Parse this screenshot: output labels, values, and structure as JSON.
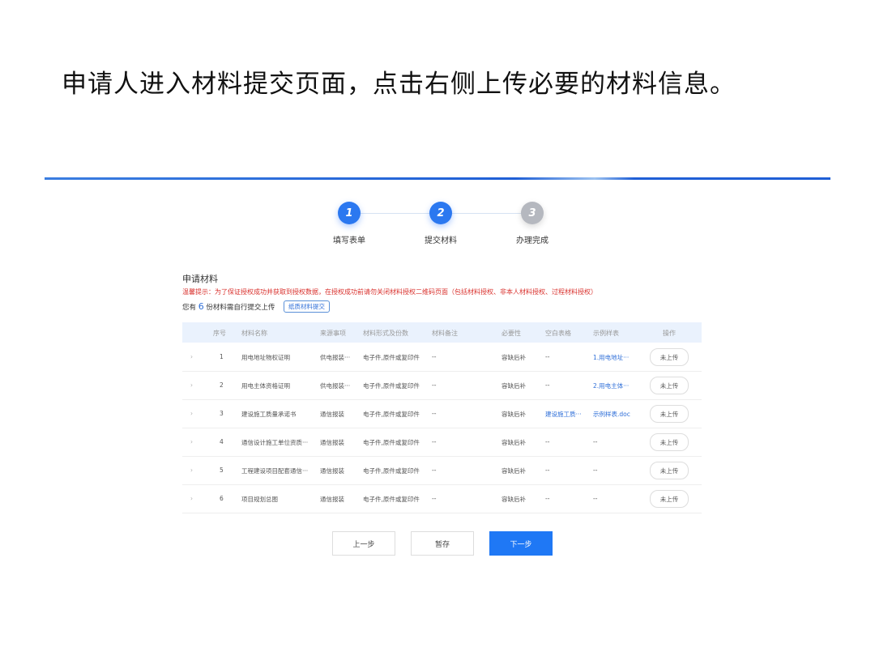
{
  "title": "申请人进入材料提交页面，点击右侧上传必要的材料信息。",
  "steps": [
    {
      "num": "1",
      "label": "填写表单"
    },
    {
      "num": "2",
      "label": "提交材料"
    },
    {
      "num": "3",
      "label": "办理完成"
    }
  ],
  "section_title": "申请材料",
  "warning": "温馨提示：为了保证授权成功并获取到授权数据，在授权成功前请勿关闭材料授权二维码页面（包括材料授权、非本人材料授权、过程材料授权）",
  "count_prefix": "您有",
  "count": "6",
  "count_suffix": "份材料需自行提交上传",
  "paper_button": "纸质材料提交",
  "headers": [
    "序号",
    "材料名称",
    "来源事项",
    "材料形式及份数",
    "材料备注",
    "必要性",
    "空白表格",
    "示例样表",
    "操作"
  ],
  "rows": [
    {
      "seq": "1",
      "name": "用电地址物权证明",
      "source": "供电报装···",
      "form": "电子件,原件或复印件",
      "note": "--",
      "required": "容缺后补",
      "blank": "--",
      "sample": "1.用电地址···",
      "action": "未上传"
    },
    {
      "seq": "2",
      "name": "用电主体资格证明",
      "source": "供电报装···",
      "form": "电子件,原件或复印件",
      "note": "--",
      "required": "容缺后补",
      "blank": "--",
      "sample": "2.用电主体···",
      "action": "未上传"
    },
    {
      "seq": "3",
      "name": "建设施工质量承诺书",
      "source": "通信报装",
      "form": "电子件,原件或复印件",
      "note": "--",
      "required": "容缺后补",
      "blank": "建设施工质···",
      "sample": "示例样表.doc",
      "action": "未上传"
    },
    {
      "seq": "4",
      "name": "通信设计施工单位资质···",
      "source": "通信报装",
      "form": "电子件,原件或复印件",
      "note": "--",
      "required": "容缺后补",
      "blank": "--",
      "sample": "--",
      "action": "未上传"
    },
    {
      "seq": "5",
      "name": "工程建设项目配套通信···",
      "source": "通信报装",
      "form": "电子件,原件或复印件",
      "note": "--",
      "required": "容缺后补",
      "blank": "--",
      "sample": "--",
      "action": "未上传"
    },
    {
      "seq": "6",
      "name": "项目规划总图",
      "source": "通信报装",
      "form": "电子件,原件或复印件",
      "note": "--",
      "required": "容缺后补",
      "blank": "--",
      "sample": "--",
      "action": "未上传"
    }
  ],
  "buttons": {
    "prev": "上一步",
    "save": "暂存",
    "next": "下一步"
  }
}
